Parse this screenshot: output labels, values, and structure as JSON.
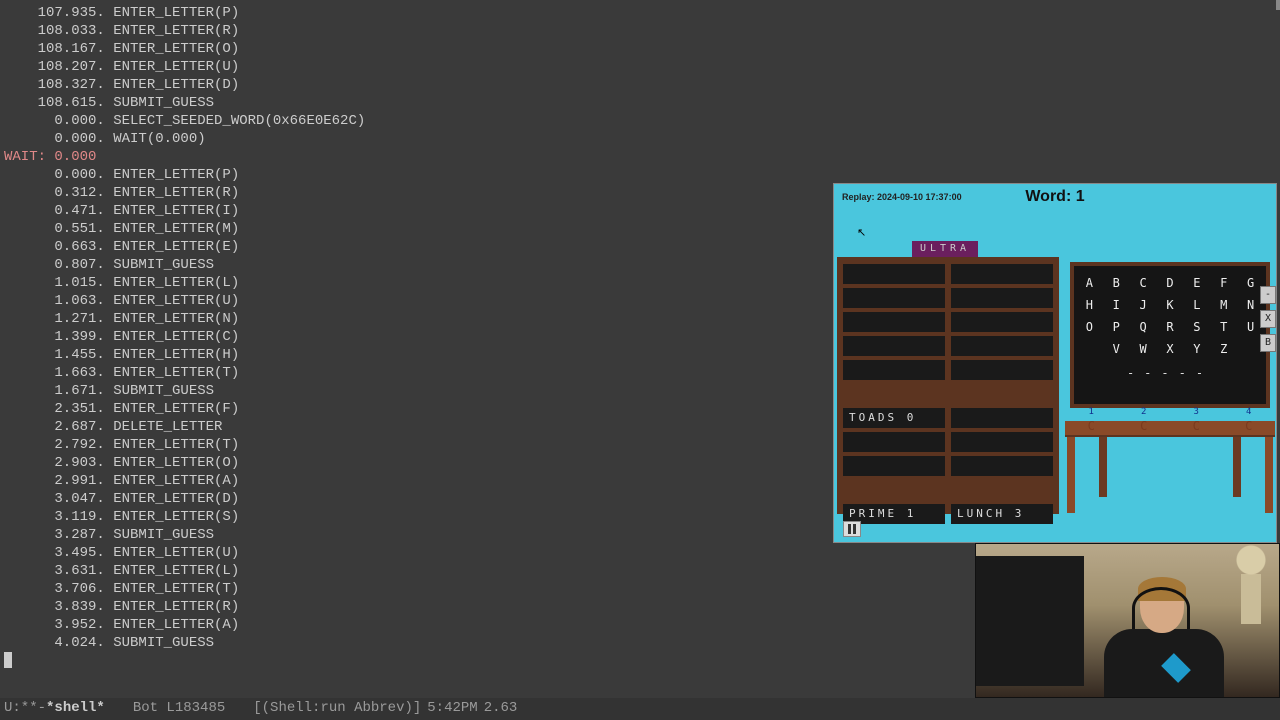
{
  "terminal": {
    "lines": [
      {
        "t": "    107.935. ENTER_LETTER(P)"
      },
      {
        "t": "    108.033. ENTER_LETTER(R)"
      },
      {
        "t": "    108.167. ENTER_LETTER(O)"
      },
      {
        "t": "    108.207. ENTER_LETTER(U)"
      },
      {
        "t": "    108.327. ENTER_LETTER(D)"
      },
      {
        "t": "    108.615. SUBMIT_GUESS"
      },
      {
        "t": "      0.000. SELECT_SEEDED_WORD(0x66E0E62C)"
      },
      {
        "t": "      0.000. WAIT(0.000)"
      },
      {
        "t": "WAIT: 0.000",
        "hl": true
      },
      {
        "t": "      0.000. ENTER_LETTER(P)"
      },
      {
        "t": "      0.312. ENTER_LETTER(R)"
      },
      {
        "t": "      0.471. ENTER_LETTER(I)"
      },
      {
        "t": "      0.551. ENTER_LETTER(M)"
      },
      {
        "t": "      0.663. ENTER_LETTER(E)"
      },
      {
        "t": "      0.807. SUBMIT_GUESS"
      },
      {
        "t": "      1.015. ENTER_LETTER(L)"
      },
      {
        "t": "      1.063. ENTER_LETTER(U)"
      },
      {
        "t": "      1.271. ENTER_LETTER(N)"
      },
      {
        "t": "      1.399. ENTER_LETTER(C)"
      },
      {
        "t": "      1.455. ENTER_LETTER(H)"
      },
      {
        "t": "      1.663. ENTER_LETTER(T)"
      },
      {
        "t": "      1.671. SUBMIT_GUESS"
      },
      {
        "t": "      2.351. ENTER_LETTER(F)"
      },
      {
        "t": "      2.687. DELETE_LETTER"
      },
      {
        "t": "      2.792. ENTER_LETTER(T)"
      },
      {
        "t": "      2.903. ENTER_LETTER(O)"
      },
      {
        "t": "      2.991. ENTER_LETTER(A)"
      },
      {
        "t": "      3.047. ENTER_LETTER(D)"
      },
      {
        "t": "      3.119. ENTER_LETTER(S)"
      },
      {
        "t": "      3.287. SUBMIT_GUESS"
      },
      {
        "t": "      3.495. ENTER_LETTER(U)"
      },
      {
        "t": "      3.631. ENTER_LETTER(L)"
      },
      {
        "t": "      3.706. ENTER_LETTER(T)"
      },
      {
        "t": "      3.839. ENTER_LETTER(R)"
      },
      {
        "t": "      3.952. ENTER_LETTER(A)"
      },
      {
        "t": "      4.024. SUBMIT_GUESS"
      }
    ]
  },
  "modeline": {
    "status": "U:**-",
    "buffer": "*shell*",
    "position": "Bot L183485",
    "modes": "[(Shell:run Abbrev)]",
    "time": "5:42PM",
    "load": "2.63"
  },
  "game": {
    "replay_label": "Replay: 2024-09-10 17:37:00",
    "word_label": "Word: 1",
    "banner": "ULTRA",
    "board_cells": [
      "",
      "",
      "",
      "",
      "",
      "",
      "",
      "",
      "",
      "",
      "TOADS 0",
      "",
      "",
      "",
      "",
      "",
      "PRIME 1",
      "LUNCH 3"
    ],
    "alphabet": [
      "A",
      "B",
      "C",
      "D",
      "E",
      "F",
      "G",
      "H",
      "I",
      "J",
      "K",
      "L",
      "M",
      "N",
      "O",
      "P",
      "Q",
      "R",
      "S",
      "T",
      "U",
      "",
      "V",
      "W",
      "X",
      "Y",
      "Z",
      ""
    ],
    "side_buttons": [
      "-",
      "X",
      "B"
    ],
    "dashes": "-----",
    "desk_numbers": [
      "1",
      "2",
      "3",
      "4"
    ],
    "desk_curves": [
      "C",
      "C",
      "C",
      "C"
    ]
  }
}
